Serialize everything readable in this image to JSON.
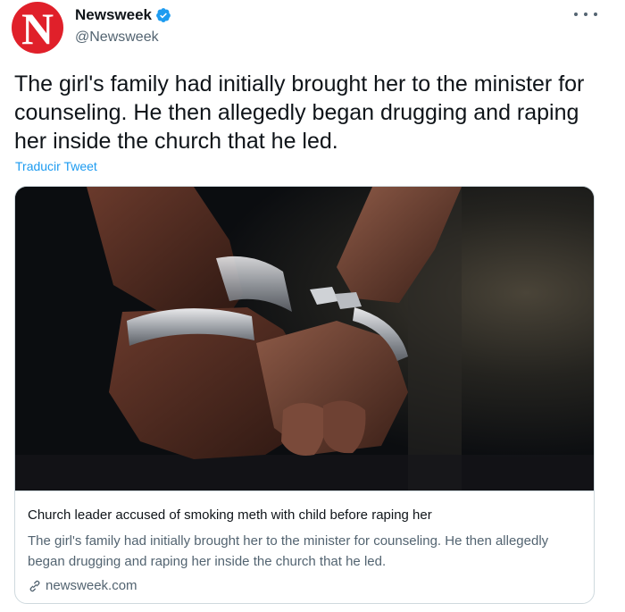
{
  "author": {
    "avatar_letter": "N",
    "name": "Newsweek",
    "handle": "@Newsweek"
  },
  "tweet": {
    "text": "The girl's family had initially brought her to the minister for counseling. He then allegedly began drugging and raping her inside the church that he led.",
    "translate_label": "Traducir Tweet"
  },
  "card": {
    "title": "Church leader accused of smoking meth with child before raping her",
    "description": "The girl's family had initially brought her to the minister for counseling. He then allegedly began drugging and raping her inside the church that he led.",
    "domain": "newsweek.com"
  },
  "icons": {
    "more": "more-dots-icon",
    "verified": "verified-badge-icon",
    "link": "link-icon"
  },
  "colors": {
    "brand_red": "#e0202a",
    "link_blue": "#1d9bf0",
    "text_primary": "#0f1419",
    "text_secondary": "#536471",
    "border": "#cfd9de"
  }
}
